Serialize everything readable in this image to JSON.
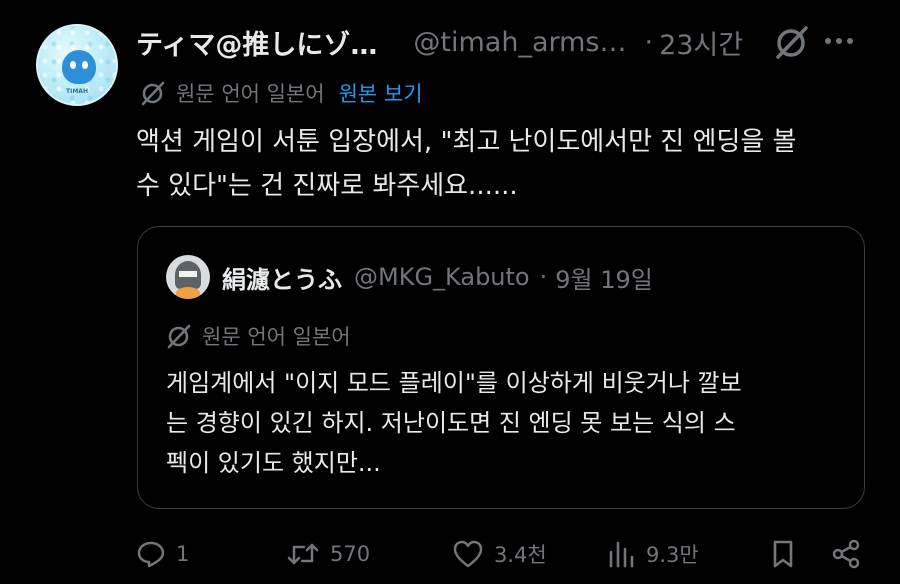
{
  "colors": {
    "background": "#000000",
    "text": "#e7e9ea",
    "muted": "#71767b",
    "link": "#1d9bf0",
    "border": "#3a3f44"
  },
  "tweet": {
    "author": {
      "display_name": "ティマ@推しにゾ…",
      "handle": "@timah_arms…",
      "separator": "·",
      "time": "23시간",
      "avatar_icon": "avatar",
      "avatar_tag": "TIMAH"
    },
    "translate": {
      "label": "원문 언어 일본어",
      "link": "원본 보기",
      "icon": "grok-translate-icon"
    },
    "text": "액션 게임이 서툰 입장에서, \"최고 난이도에서만 진 엔딩을 볼\n수 있다\"는 건 진짜로 봐주세요......",
    "header_icons": [
      "grok-icon",
      "more-icon"
    ]
  },
  "quote": {
    "author": {
      "display_name": "絹濾とうふ",
      "handle": "@MKG_Kabuto",
      "separator": "·",
      "time": "9월 19일"
    },
    "translate": {
      "label": "원문 언어 일본어"
    },
    "text": "게임계에서 \"이지 모드 플레이\"를 이상하게 비웃거나 깔보\n는 경향이 있긴 하지. 저난이도면 진 엔딩 못 보는 식의 스\n펙이 있기도 했지만..."
  },
  "actions": {
    "reply": {
      "icon": "reply-icon",
      "count": "1"
    },
    "retweet": {
      "icon": "retweet-icon",
      "count": "570"
    },
    "like": {
      "icon": "heart-icon",
      "count": "3.4천"
    },
    "views": {
      "icon": "views-icon",
      "count": "9.3만"
    },
    "bookmark": {
      "icon": "bookmark-icon"
    },
    "share": {
      "icon": "share-icon"
    }
  }
}
